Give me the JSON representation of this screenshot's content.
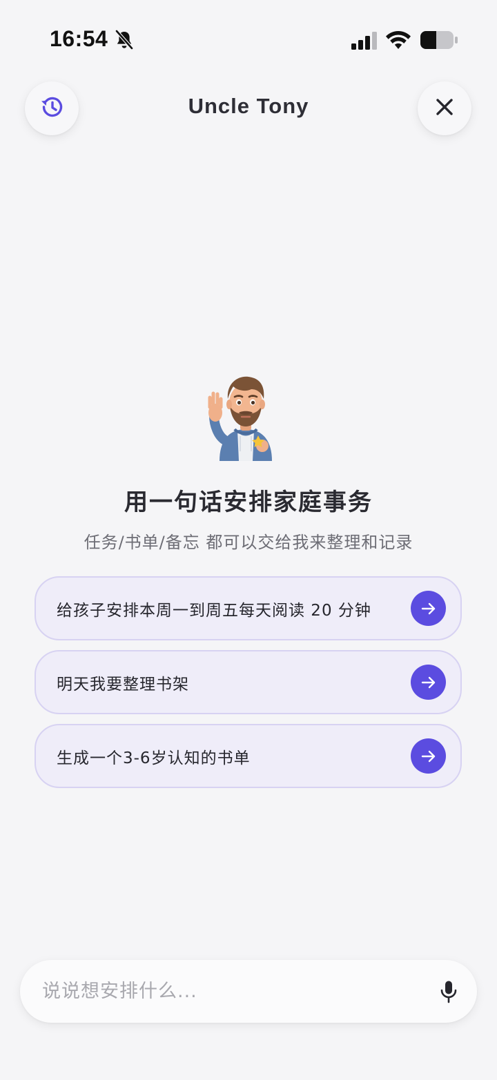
{
  "status_bar": {
    "time": "16:54",
    "icons": [
      "bell-slash-icon",
      "cellular-signal-icon",
      "wifi-icon",
      "battery-icon"
    ]
  },
  "header": {
    "title": "Uncle Tony",
    "left_icon": "history-icon",
    "right_icon": "close-icon"
  },
  "hero": {
    "avatar": "waving-man-avatar",
    "headline": "用一句话安排家庭事务",
    "subline": "任务/书单/备忘 都可以交给我来整理和记录"
  },
  "suggestions": [
    {
      "label": "给孩子安排本周一到周五每天阅读 20 分钟",
      "icon": "arrow-right-icon"
    },
    {
      "label": "明天我要整理书架",
      "icon": "arrow-right-icon"
    },
    {
      "label": "生成一个3-6岁认知的书单",
      "icon": "arrow-right-icon"
    }
  ],
  "input": {
    "placeholder": "说说想安排什么...",
    "value": "",
    "icon": "microphone-icon"
  },
  "colors": {
    "background": "#f5f5f7",
    "accent": "#5b4ce0",
    "suggestion_bg": "#efedf9",
    "suggestion_border": "#d7d2f2"
  }
}
